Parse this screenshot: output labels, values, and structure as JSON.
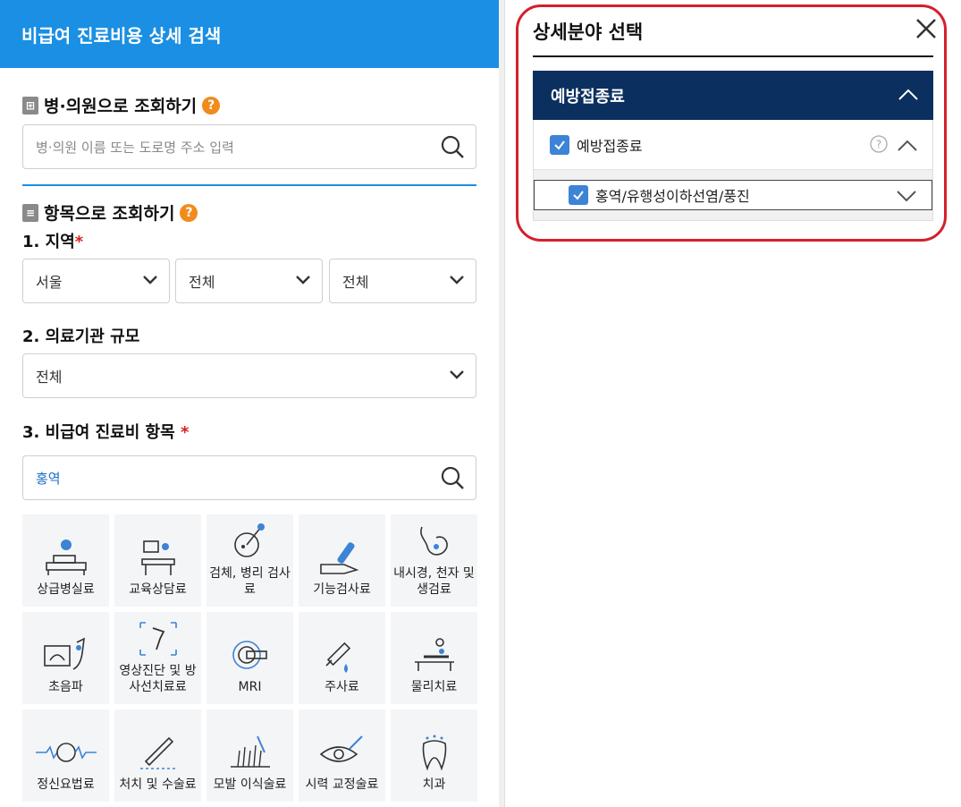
{
  "left": {
    "header_title": "비급여 진료비용 상세 검색",
    "hospital_section": {
      "title": "병·의원으로 조회하기",
      "help": "?",
      "search_placeholder": "병·의원 이름 또는 도로명 주소 입력"
    },
    "item_section": {
      "title": "항목으로 조회하기",
      "help": "?"
    },
    "region": {
      "label": "1. 지역",
      "required": "*",
      "sido": "서울",
      "sigungu": "전체",
      "dong": "전체"
    },
    "facility": {
      "label": "2. 의료기관 규모",
      "value": "전체"
    },
    "item": {
      "label": "3. 비급여 진료비 항목",
      "required": "*",
      "search_value": "홍역"
    },
    "categories": [
      {
        "label": "상급병실료",
        "icon": "hospital-bed-icon"
      },
      {
        "label": "교육상담료",
        "icon": "counseling-icon"
      },
      {
        "label": "검체, 병리 검사료",
        "icon": "specimen-test-icon"
      },
      {
        "label": "기능검사료",
        "icon": "function-test-icon"
      },
      {
        "label": "내시경, 천자 및 생검료",
        "icon": "endoscope-icon"
      },
      {
        "label": "초음파",
        "icon": "ultrasound-icon"
      },
      {
        "label": "영상진단 및 방사선치료료",
        "icon": "xray-icon"
      },
      {
        "label": "MRI",
        "icon": "mri-icon"
      },
      {
        "label": "주사료",
        "icon": "syringe-icon"
      },
      {
        "label": "물리치료",
        "icon": "physical-therapy-icon"
      },
      {
        "label": "정신요법료",
        "icon": "brain-wave-icon"
      },
      {
        "label": "처치 및 수술료",
        "icon": "surgery-icon"
      },
      {
        "label": "모발 이식술료",
        "icon": "hair-transplant-icon"
      },
      {
        "label": "시력 교정술료",
        "icon": "eye-correction-icon"
      },
      {
        "label": "치과",
        "icon": "tooth-icon"
      }
    ]
  },
  "right": {
    "title": "상세분야 선택",
    "accordion_title": "예방접종료",
    "child_label": "예방접종료",
    "grandchild_label": "홍역/유행성이하선염/풍진"
  },
  "colors": {
    "header_blue": "#1a8fe3",
    "accordion_navy": "#0b2f5e",
    "checkbox_blue": "#3d83d6",
    "help_orange": "#f08b1c",
    "highlight_red": "#d4202c"
  }
}
